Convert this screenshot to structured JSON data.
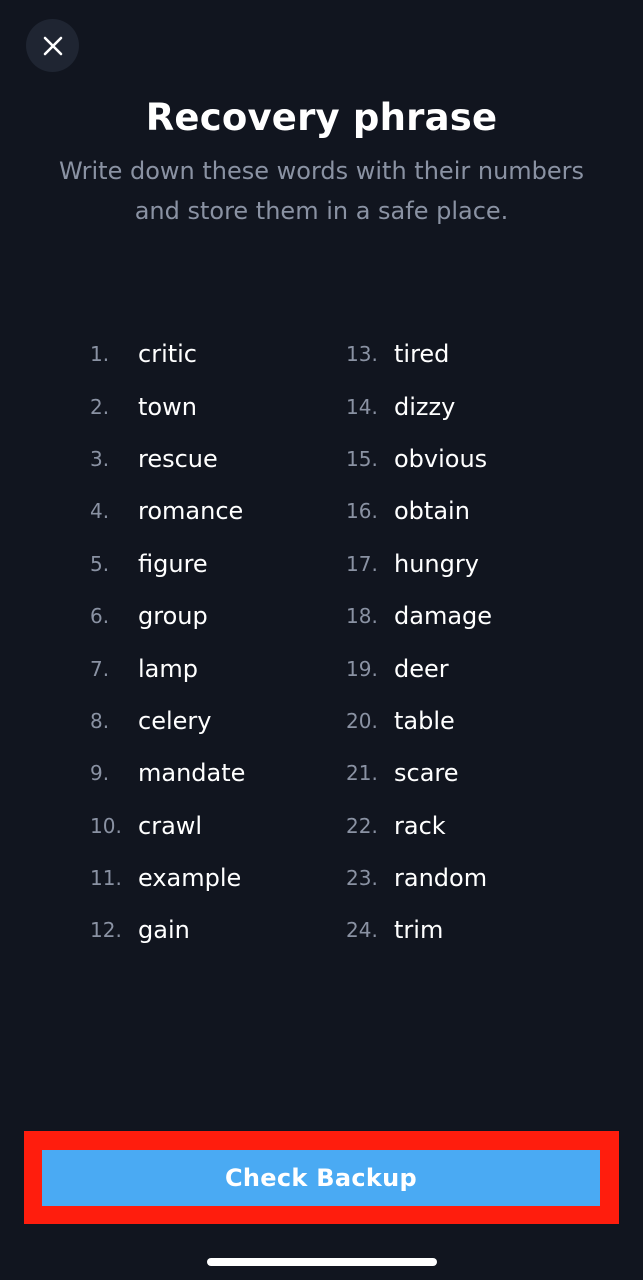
{
  "header": {
    "close_icon": "close-icon",
    "title": "Recovery phrase",
    "subtitle": "Write down these words with their numbers and store them in a safe place."
  },
  "recovery_words": [
    {
      "number": "1.",
      "word": "critic"
    },
    {
      "number": "2.",
      "word": "town"
    },
    {
      "number": "3.",
      "word": "rescue"
    },
    {
      "number": "4.",
      "word": "romance"
    },
    {
      "number": "5.",
      "word": "figure"
    },
    {
      "number": "6.",
      "word": "group"
    },
    {
      "number": "7.",
      "word": "lamp"
    },
    {
      "number": "8.",
      "word": "celery"
    },
    {
      "number": "9.",
      "word": "mandate"
    },
    {
      "number": "10.",
      "word": "crawl"
    },
    {
      "number": "11.",
      "word": "example"
    },
    {
      "number": "12.",
      "word": "gain"
    },
    {
      "number": "13.",
      "word": "tired"
    },
    {
      "number": "14.",
      "word": "dizzy"
    },
    {
      "number": "15.",
      "word": "obvious"
    },
    {
      "number": "16.",
      "word": "obtain"
    },
    {
      "number": "17.",
      "word": "hungry"
    },
    {
      "number": "18.",
      "word": "damage"
    },
    {
      "number": "19.",
      "word": "deer"
    },
    {
      "number": "20.",
      "word": "table"
    },
    {
      "number": "21.",
      "word": "scare"
    },
    {
      "number": "22.",
      "word": "rack"
    },
    {
      "number": "23.",
      "word": "random"
    },
    {
      "number": "24.",
      "word": "trim"
    }
  ],
  "footer": {
    "check_backup_label": "Check Backup"
  },
  "colors": {
    "background": "#11151f",
    "close_button_bg": "#1f2532",
    "muted_text": "#8a92a3",
    "primary_button": "#4aaaf3",
    "highlight": "#ff1d0d"
  }
}
